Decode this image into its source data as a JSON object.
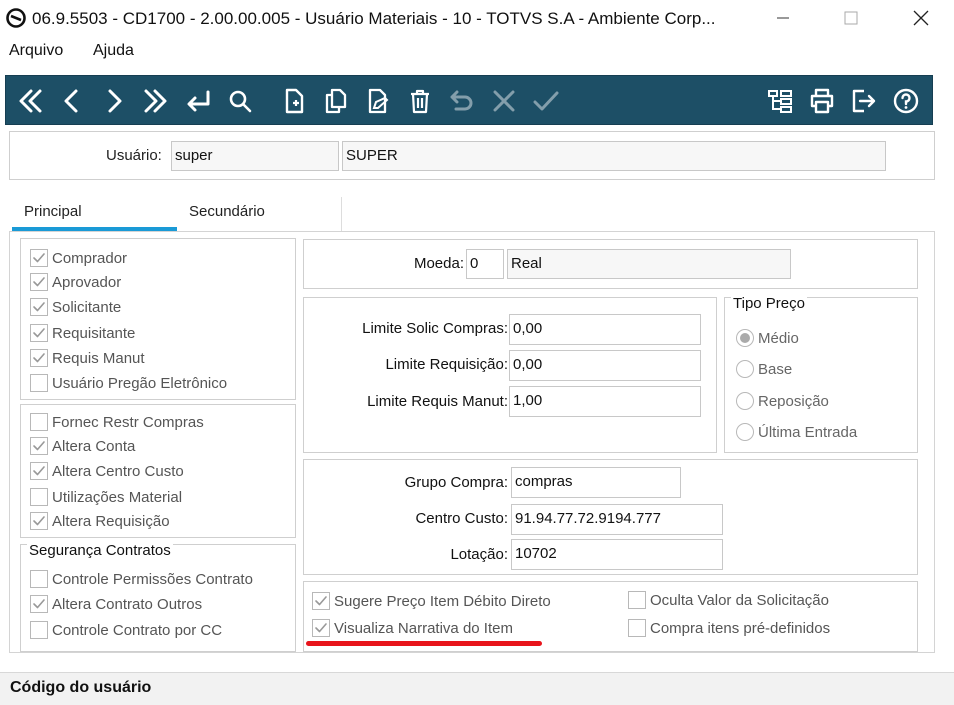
{
  "window": {
    "title": "06.9.5503 - CD1700 - 2.00.00.005 - Usuário Materiais - 10 - TOTVS S.A - Ambiente Corp...",
    "minimize_icon": "minimize-icon",
    "maximize_icon": "maximize-icon",
    "close_icon": "close-icon"
  },
  "menu": {
    "items": [
      "Arquivo",
      "Ajuda"
    ]
  },
  "toolbar": {
    "background": "#1d4f66",
    "buttons": [
      "first-record-icon",
      "previous-record-icon",
      "next-record-icon",
      "last-record-icon",
      "goto-icon",
      "search-icon",
      "new-record-icon",
      "copy-record-icon",
      "edit-record-icon",
      "delete-record-icon",
      "undo-icon",
      "cancel-icon",
      "save-icon",
      "tree-structure-icon",
      "print-icon",
      "exit-icon",
      "help-icon"
    ]
  },
  "header": {
    "usuario_label": "Usuário:",
    "usuario_code": "super",
    "usuario_name": "SUPER"
  },
  "tabs": [
    "Principal",
    "Secundário"
  ],
  "perfil": [
    {
      "label": "Comprador",
      "checked": true
    },
    {
      "label": "Aprovador",
      "checked": true
    },
    {
      "label": "Solicitante",
      "checked": true
    },
    {
      "label": "Requisitante",
      "checked": true
    },
    {
      "label": "Requis Manut",
      "checked": true
    },
    {
      "label": "Usuário Pregão Eletrônico",
      "checked": false
    }
  ],
  "permissoes": [
    {
      "label": "Fornec Restr Compras",
      "checked": false
    },
    {
      "label": "Altera Conta",
      "checked": true
    },
    {
      "label": "Altera Centro Custo",
      "checked": true
    },
    {
      "label": "Utilizações Material",
      "checked": false
    },
    {
      "label": "Altera Requisição",
      "checked": true
    }
  ],
  "seguranca": {
    "title": "Segurança Contratos",
    "items": [
      {
        "label": "Controle Permissões Contrato",
        "checked": false
      },
      {
        "label": "Altera Contrato Outros",
        "checked": true
      },
      {
        "label": "Controle Contrato por CC",
        "checked": false
      }
    ]
  },
  "moeda": {
    "label": "Moeda:",
    "code": "0",
    "name": "Real"
  },
  "limites": [
    {
      "label": "Limite Solic Compras:",
      "value": "0,00"
    },
    {
      "label": "Limite Requisição:",
      "value": "0,00"
    },
    {
      "label": "Limite Requis Manut:",
      "value": "1,00"
    }
  ],
  "tipo_preco": {
    "title": "Tipo Preço",
    "options": [
      {
        "label": "Médio",
        "selected": true
      },
      {
        "label": "Base",
        "selected": false
      },
      {
        "label": "Reposição",
        "selected": false
      },
      {
        "label": "Última Entrada",
        "selected": false
      }
    ]
  },
  "grupo": [
    {
      "label": "Grupo Compra:",
      "value": "compras"
    },
    {
      "label": "Centro Custo:",
      "value": "91.94.77.72.9194.777"
    },
    {
      "label": "Lotação:",
      "value": "10702"
    }
  ],
  "opcoes": [
    {
      "label": "Sugere Preço Item Débito Direto",
      "checked": true
    },
    {
      "label": "Visualiza Narrativa do Item",
      "checked": true
    },
    {
      "label": "Oculta Valor da Solicitação",
      "checked": false
    },
    {
      "label": "Compra itens pré-definidos",
      "checked": false
    }
  ],
  "annotation_color": "#e8141b",
  "status": {
    "text": "Código do usuário"
  }
}
